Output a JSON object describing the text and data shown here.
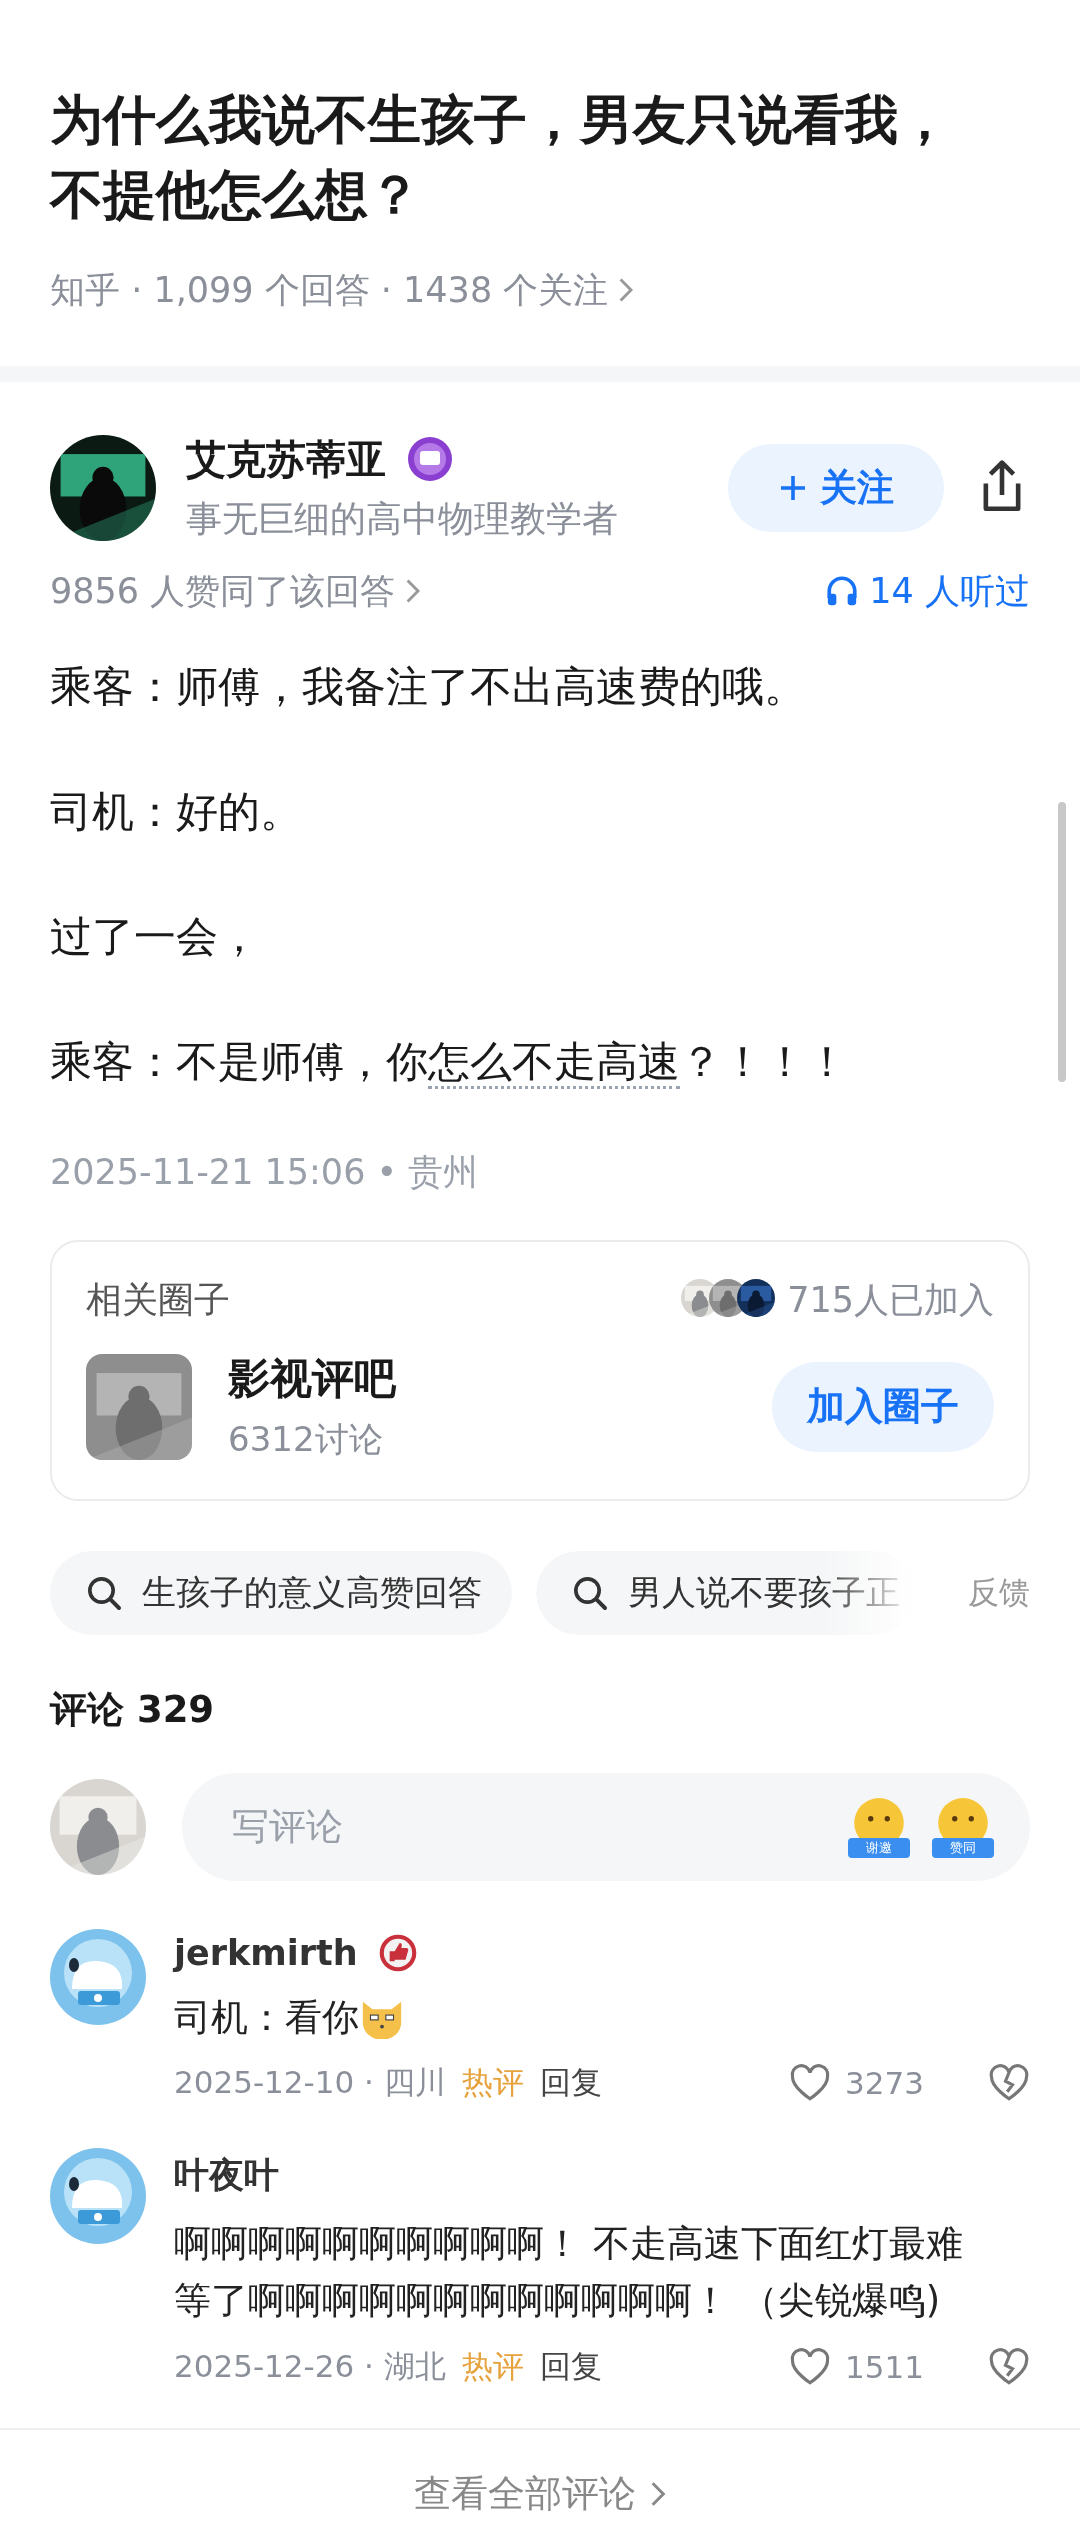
{
  "question": {
    "title_lines": [
      "为什么我说不生孩子，男友只说看我，",
      "不提他怎么想？"
    ],
    "meta": "知乎 · 1,099 个回答 · 1438 个关注"
  },
  "answer": {
    "author": {
      "name": "艾克苏蒂亚",
      "bio": "事无巨细的高中物理教学者"
    },
    "follow_button": "关注",
    "upvotes": "9856 人赞同了该回答",
    "listens": "14 人听过",
    "paragraphs": [
      {
        "segments": [
          {
            "kind": "plain",
            "text": "乘客：师傅，我备注了不出高速费的哦。"
          }
        ]
      },
      {
        "segments": [
          {
            "kind": "plain",
            "text": "司机：好的。"
          }
        ]
      },
      {
        "segments": [
          {
            "kind": "plain",
            "text": "过了一会，"
          }
        ]
      },
      {
        "segments": [
          {
            "kind": "plain",
            "text": "乘客：不是师傅，你"
          },
          {
            "kind": "link",
            "text": "怎么不走高速"
          },
          {
            "kind": "plain",
            "text": "？！！！"
          }
        ]
      }
    ],
    "timestamp": "2025-11-21 15:06 • 贵州"
  },
  "circle": {
    "heading": "相关圈子",
    "members": "715人已加入",
    "name": "影视评吧",
    "discussions": "6312讨论",
    "join_button": "加入圈子"
  },
  "related_searches": [
    {
      "text": "生孩子的意义高赞回答",
      "faded": false
    },
    {
      "text": "男人说不要孩子正",
      "faded": true
    }
  ],
  "feedback": "反馈",
  "comments": {
    "heading": "评论 329",
    "input_placeholder": "写评论",
    "quick_replies": [
      "谢邀",
      "赞同"
    ],
    "items": [
      {
        "name": "jerkmirth",
        "badge": true,
        "lines": [
          "司机：看你"
        ],
        "emoji": true,
        "meta": "2025-12-10 · 四川",
        "hot": "热评",
        "reply": "回复",
        "likes": "3273"
      },
      {
        "name": "叶夜叶",
        "badge": false,
        "lines": [
          "啊啊啊啊啊啊啊啊啊啊！ 不走高速下面红灯最难",
          "等了啊啊啊啊啊啊啊啊啊啊啊啊！ （尖锐爆鸣)"
        ],
        "emoji": false,
        "meta": "2025-12-26 · 湖北",
        "hot": "热评",
        "reply": "回复",
        "likes": "1511"
      }
    ],
    "view_all": "查看全部评论"
  }
}
